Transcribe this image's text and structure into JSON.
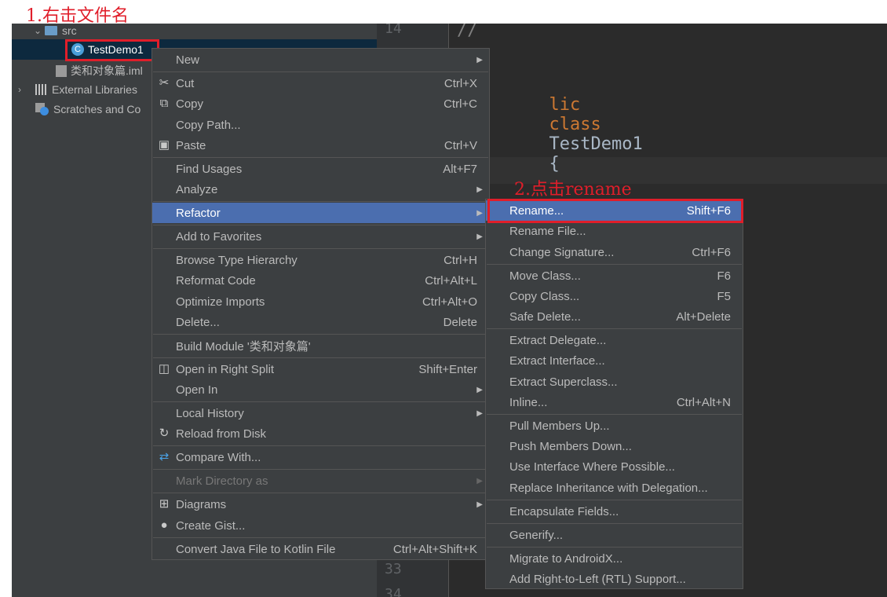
{
  "annotations": {
    "step1": "1.右击文件名",
    "step2": "2.点击rename"
  },
  "gutter": {
    "line_top": "14",
    "line_33": "33",
    "line_34": "34"
  },
  "editor": {
    "comment": "//",
    "code_keyword1": "lic",
    "code_keyword2": "class",
    "code_class": "TestDemo1",
    "code_brace": "{"
  },
  "project_tree": {
    "items": [
      {
        "label": "src",
        "icon": "folder-icon",
        "expanded": true
      },
      {
        "label": "TestDemo1",
        "icon": "java-class-icon",
        "selected": true
      },
      {
        "label": "类和对象篇.iml",
        "icon": "iml-file-icon"
      },
      {
        "label": "External Libraries",
        "icon": "library-icon",
        "expanded": false
      },
      {
        "label": "Scratches and Co",
        "icon": "scratches-icon"
      }
    ]
  },
  "context_menu": {
    "items": [
      {
        "label": "New",
        "shortcut": "",
        "submenu": true
      },
      {
        "label": "Cut",
        "shortcut": "Ctrl+X",
        "icon": "scissors-icon"
      },
      {
        "label": "Copy",
        "shortcut": "Ctrl+C",
        "icon": "copy-icon"
      },
      {
        "label": "Copy Path...",
        "shortcut": ""
      },
      {
        "label": "Paste",
        "shortcut": "Ctrl+V",
        "icon": "clipboard-icon"
      },
      {
        "label": "Find Usages",
        "shortcut": "Alt+F7"
      },
      {
        "label": "Analyze",
        "shortcut": "",
        "submenu": true
      },
      {
        "label": "Refactor",
        "shortcut": "",
        "submenu": true,
        "highlighted": true
      },
      {
        "label": "Add to Favorites",
        "shortcut": "",
        "submenu": true
      },
      {
        "label": "Browse Type Hierarchy",
        "shortcut": "Ctrl+H"
      },
      {
        "label": "Reformat Code",
        "shortcut": "Ctrl+Alt+L"
      },
      {
        "label": "Optimize Imports",
        "shortcut": "Ctrl+Alt+O"
      },
      {
        "label": "Delete...",
        "shortcut": "Delete"
      },
      {
        "label": "Build Module '类和对象篇'",
        "shortcut": ""
      },
      {
        "label": "Open in Right Split",
        "shortcut": "Shift+Enter",
        "icon": "split-icon"
      },
      {
        "label": "Open In",
        "shortcut": "",
        "submenu": true
      },
      {
        "label": "Local History",
        "shortcut": "",
        "submenu": true
      },
      {
        "label": "Reload from Disk",
        "shortcut": "",
        "icon": "reload-icon"
      },
      {
        "label": "Compare With...",
        "shortcut": "",
        "icon": "compare-icon"
      },
      {
        "label": "Mark Directory as",
        "shortcut": "",
        "submenu": true,
        "disabled": true
      },
      {
        "label": "Diagrams",
        "shortcut": "",
        "submenu": true,
        "icon": "diagram-icon"
      },
      {
        "label": "Create Gist...",
        "shortcut": "",
        "icon": "github-icon"
      },
      {
        "label": "Convert Java File to Kotlin File",
        "shortcut": "Ctrl+Alt+Shift+K"
      }
    ]
  },
  "refactor_submenu": {
    "items": [
      {
        "label": "Rename...",
        "shortcut": "Shift+F6",
        "highlighted": true
      },
      {
        "label": "Rename File...",
        "shortcut": ""
      },
      {
        "label": "Change Signature...",
        "shortcut": "Ctrl+F6"
      },
      {
        "label": "Move Class...",
        "shortcut": "F6"
      },
      {
        "label": "Copy Class...",
        "shortcut": "F5"
      },
      {
        "label": "Safe Delete...",
        "shortcut": "Alt+Delete"
      },
      {
        "label": "Extract Delegate...",
        "shortcut": ""
      },
      {
        "label": "Extract Interface...",
        "shortcut": ""
      },
      {
        "label": "Extract Superclass...",
        "shortcut": ""
      },
      {
        "label": "Inline...",
        "shortcut": "Ctrl+Alt+N"
      },
      {
        "label": "Pull Members Up...",
        "shortcut": ""
      },
      {
        "label": "Push Members Down...",
        "shortcut": ""
      },
      {
        "label": "Use Interface Where Possible...",
        "shortcut": ""
      },
      {
        "label": "Replace Inheritance with Delegation...",
        "shortcut": ""
      },
      {
        "label": "Encapsulate Fields...",
        "shortcut": ""
      },
      {
        "label": "Generify...",
        "shortcut": ""
      },
      {
        "label": "Migrate to AndroidX...",
        "shortcut": ""
      },
      {
        "label": "Add Right-to-Left (RTL) Support...",
        "shortcut": ""
      }
    ]
  },
  "colors": {
    "highlight": "#4b6eaf",
    "annotation_red": "#e01e2a",
    "menu_bg": "#3c3f41",
    "editor_bg": "#2b2b2b"
  }
}
